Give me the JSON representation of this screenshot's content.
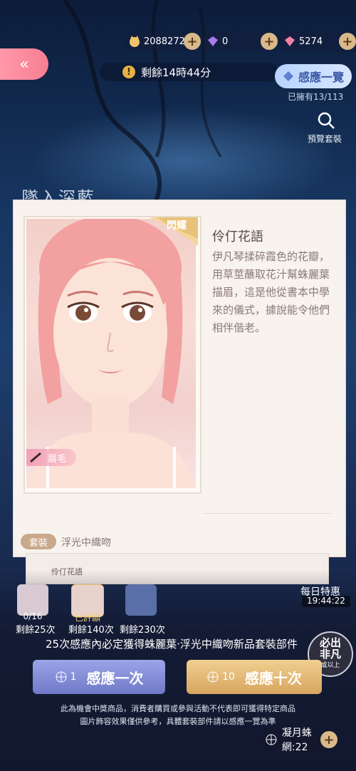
{
  "currencies": [
    {
      "icon": "cat-coin-icon",
      "value": "20882724"
    },
    {
      "icon": "purple-diamond-icon",
      "value": "0"
    },
    {
      "icon": "pink-diamond-icon",
      "value": "5274"
    }
  ],
  "timer": {
    "text": "剩餘14時44分"
  },
  "overview": {
    "label": "感應一覽",
    "owned": "已擁有13/113"
  },
  "preview": {
    "label": "預覽套裝"
  },
  "background_title": "墜入深藍",
  "card": {
    "badge": "閃耀",
    "part_label": "眉毛",
    "item_title": "伶仃花語",
    "item_description": "伊凡琴揉碎霞色的花瓣，用草莖蘸取花汁幫蛛麗葉描眉，這是他從書本中學來的儀式，據說能令他們相伴偕老。",
    "set_tag": "套裝",
    "set_name": "浮光中織吻",
    "sub_item_name": "伶仃花語"
  },
  "rewards": [
    {
      "count": "0/16",
      "remaining": "剩餘25次"
    },
    {
      "count": "已許願",
      "remaining": "剩餘140次"
    },
    {
      "count": "",
      "remaining": "剩餘230次"
    }
  ],
  "daily": {
    "label": "每日特惠",
    "time": "19:44:22"
  },
  "guarantee_text": "25次感應內必定獲得蛛麗葉·浮光中織吻新品套裝部件",
  "must_badge": {
    "line1": "必出",
    "line2": "非凡",
    "line3": "或以上"
  },
  "buttons": {
    "draw_one": {
      "num": "1",
      "label": "感應一次"
    },
    "draw_ten": {
      "num": "10",
      "label": "感應十次"
    }
  },
  "disclaimer": [
    "此為機會中獎商品，消費者購買或參與活動不代表即可獲得特定商品",
    "圖片飾容效果僅供參考，具體套裝部件請以感應一覽為準"
  ],
  "web_currency": {
    "label": "凝月蛛網:22"
  },
  "colors": {
    "accent_pink": "#f67f92",
    "gold": "#d8a560",
    "lavender": "#6f79c7"
  }
}
